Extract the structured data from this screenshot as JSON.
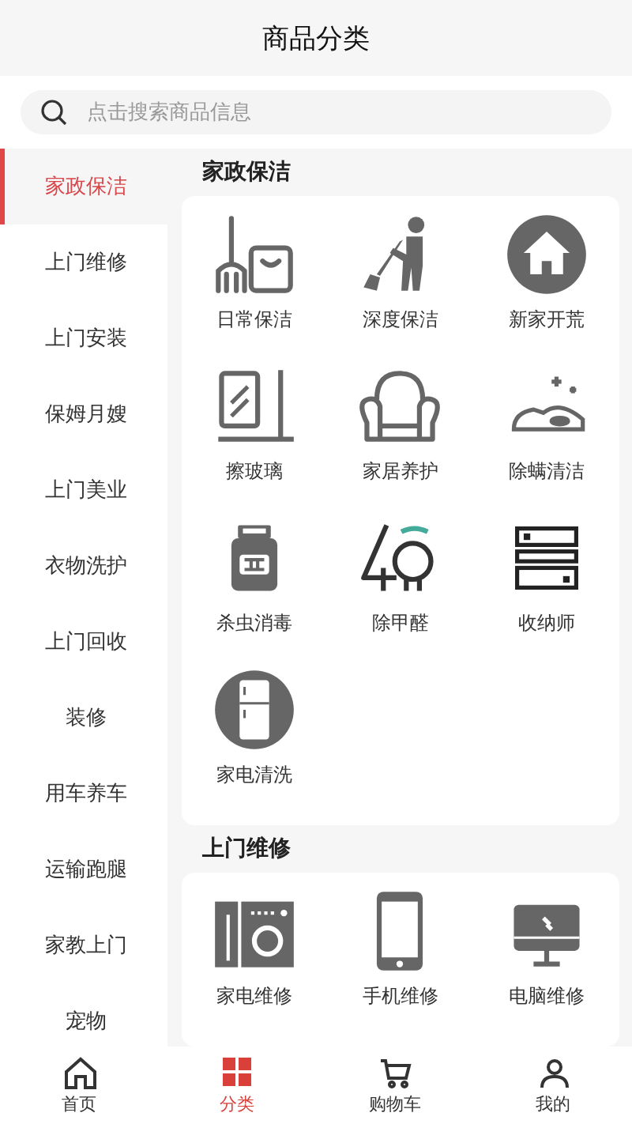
{
  "header": {
    "title": "商品分类"
  },
  "search": {
    "placeholder": "点击搜索商品信息"
  },
  "sidebar": {
    "items": [
      {
        "label": "家政保洁",
        "selected": true
      },
      {
        "label": "上门维修",
        "selected": false
      },
      {
        "label": "上门安装",
        "selected": false
      },
      {
        "label": "保姆月嫂",
        "selected": false
      },
      {
        "label": "上门美业",
        "selected": false
      },
      {
        "label": "衣物洗护",
        "selected": false
      },
      {
        "label": "上门回收",
        "selected": false
      },
      {
        "label": "装修",
        "selected": false
      },
      {
        "label": "用车养车",
        "selected": false
      },
      {
        "label": "运输跑腿",
        "selected": false
      },
      {
        "label": "家教上门",
        "selected": false
      },
      {
        "label": "宠物",
        "selected": false
      }
    ]
  },
  "sections": [
    {
      "title": "家政保洁",
      "items": [
        {
          "label": "日常保洁"
        },
        {
          "label": "深度保洁"
        },
        {
          "label": "新家开荒"
        },
        {
          "label": "擦玻璃"
        },
        {
          "label": "家居养护"
        },
        {
          "label": "除螨清洁"
        },
        {
          "label": "杀虫消毒"
        },
        {
          "label": "除甲醛"
        },
        {
          "label": "收纳师"
        },
        {
          "label": "家电清洗"
        }
      ]
    },
    {
      "title": "上门维修",
      "items": [
        {
          "label": "家电维修"
        },
        {
          "label": "手机维修"
        },
        {
          "label": "电脑维修"
        }
      ]
    }
  ],
  "tab_bar": [
    {
      "label": "首页",
      "selected": false
    },
    {
      "label": "分类",
      "selected": true
    },
    {
      "label": "购物车",
      "selected": false
    },
    {
      "label": "我的",
      "selected": false
    }
  ]
}
